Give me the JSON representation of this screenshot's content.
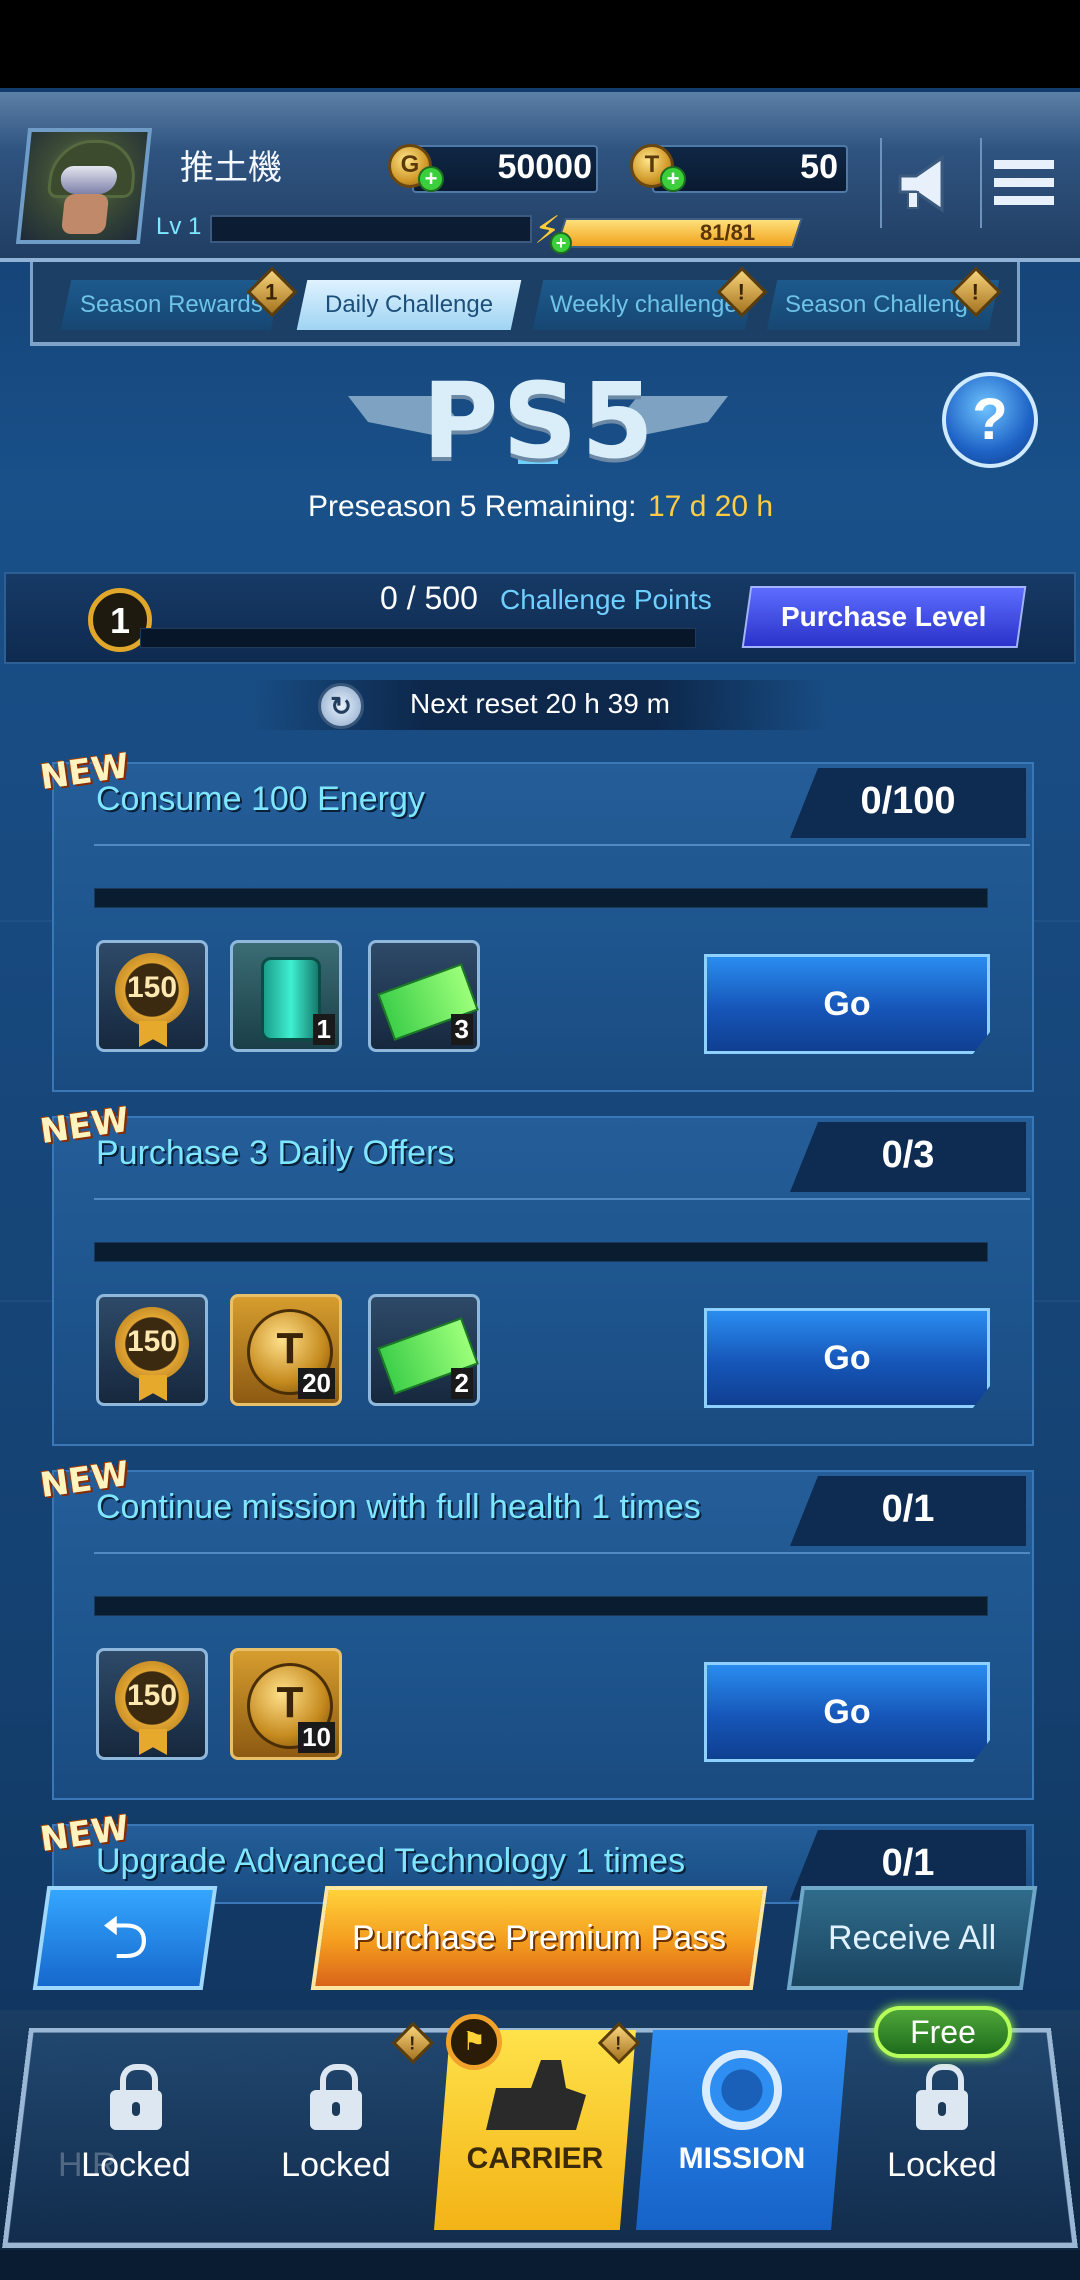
{
  "header": {
    "player_name": "推土機",
    "level_label": "Lv 1",
    "gold_value": "50000",
    "ticket_value": "50",
    "energy_text": "81/81",
    "energy_fraction": 1.0
  },
  "tabs": [
    {
      "label": "Season Rewards",
      "badge": "1"
    },
    {
      "label": "Daily Challenge",
      "badge": ""
    },
    {
      "label": "Weekly challenge",
      "badge": "!"
    },
    {
      "label": "Season Challenge",
      "badge": "!"
    }
  ],
  "season": {
    "logo_text": "PS5",
    "remaining_label": "Preseason 5 Remaining:",
    "remaining_value": "17 d 20 h",
    "help_glyph": "?"
  },
  "points": {
    "level": "1",
    "value": "0 / 500",
    "label": "Challenge Points",
    "purchase_button": "Purchase Level",
    "progress_fraction": 0
  },
  "reset": {
    "text": "Next reset 20 h 39 m"
  },
  "challenges": [
    {
      "new_tag": "NEW",
      "title": "Consume 100 Energy",
      "progress": "0/100",
      "rewards": [
        {
          "type": "medal",
          "value": "150"
        },
        {
          "type": "energy-canister",
          "count": "1"
        },
        {
          "type": "ticket",
          "count": "3"
        }
      ],
      "button": "Go"
    },
    {
      "new_tag": "NEW",
      "title": "Purchase 3 Daily Offers",
      "progress": "0/3",
      "rewards": [
        {
          "type": "medal",
          "value": "150"
        },
        {
          "type": "t-coin",
          "count": "20"
        },
        {
          "type": "ticket",
          "count": "2"
        }
      ],
      "button": "Go"
    },
    {
      "new_tag": "NEW",
      "title": "Continue mission with full health 1 times",
      "progress": "0/1",
      "rewards": [
        {
          "type": "medal",
          "value": "150"
        },
        {
          "type": "t-coin",
          "count": "10"
        }
      ],
      "button": "Go"
    },
    {
      "new_tag": "NEW",
      "title": "Upgrade Advanced Technology 1 times",
      "progress": "0/1"
    }
  ],
  "actions": {
    "back_glyph": "⮌",
    "premium_button": "Purchase Premium Pass",
    "receive_all_button": "Receive All"
  },
  "nav": {
    "items": [
      {
        "label": "Locked"
      },
      {
        "label": "Locked"
      },
      {
        "label": "CARRIER"
      },
      {
        "label": "MISSION"
      },
      {
        "label": "Locked"
      }
    ],
    "free_badge": "Free"
  },
  "colors": {
    "accent_gold": "#ffcc44",
    "title_cyan": "#7fe6ff",
    "button_blue": "#1656b8",
    "carrier_yellow": "#f3b316"
  }
}
